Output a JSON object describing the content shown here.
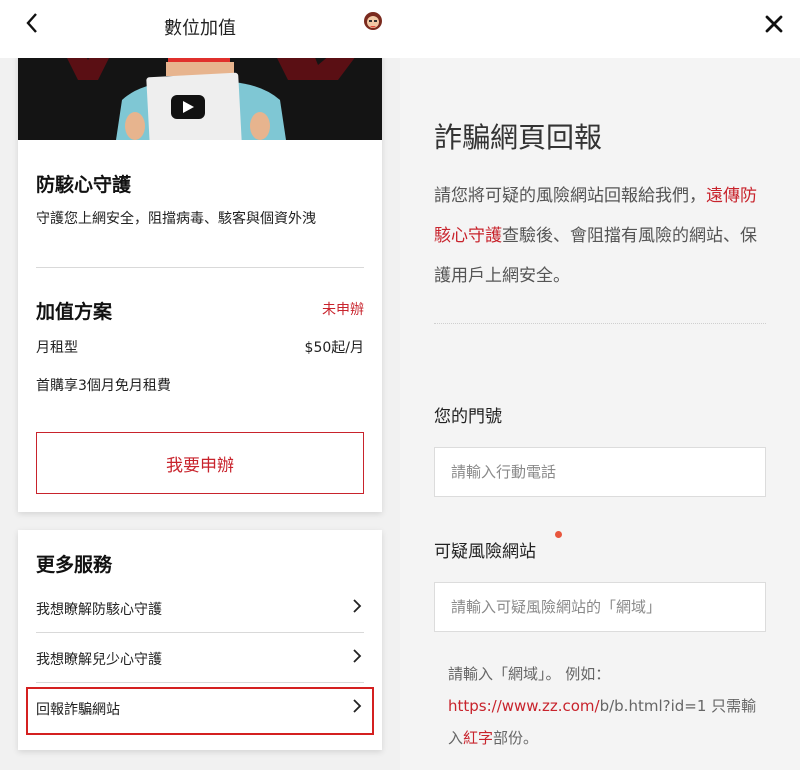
{
  "header": {
    "title": "數位加值",
    "back_icon": "chevron-left-icon",
    "avatar_icon": "user-avatar-icon"
  },
  "plan": {
    "title": "防駭心守護",
    "description": "守護您上網安全，阻擋病毒、駭客與個資外洩"
  },
  "addon": {
    "title": "加值方案",
    "status": "未申辦",
    "price_label": "月租型",
    "price_value": "$50起/月",
    "promo": "首購享3個月免月租費",
    "apply_label": "我要申辦"
  },
  "more_services": {
    "title": "更多服務",
    "items": [
      {
        "label": "我想瞭解防駭心守護"
      },
      {
        "label": "我想瞭解兒少心守護"
      },
      {
        "label": "回報詐騙網站"
      }
    ]
  },
  "report": {
    "close_icon": "close-icon",
    "title": "詐騙網頁回報",
    "intro_part1": "請您將可疑的風險網站回報給我們，",
    "intro_highlight": "遠傳防駭心守護",
    "intro_part2": "查驗後、會阻擋有風險的網站、保護用戶上網安全。",
    "phone_label": "您的門號",
    "phone_placeholder": "請輸入行動電話",
    "site_label": "可疑風險網站",
    "site_placeholder": "請輸入可疑風險網站的「網域」",
    "hint_part1": "請輸入「網域」。 例如：",
    "hint_example_red": "https://www.zz.com/",
    "hint_example_rest": "b/b.html?id=1 只需輸入",
    "hint_red_word": "紅字",
    "hint_part2": "部份。"
  },
  "colors": {
    "accent": "#c8232c",
    "highlight_box": "#d42020",
    "required_dot": "#e8563d"
  }
}
